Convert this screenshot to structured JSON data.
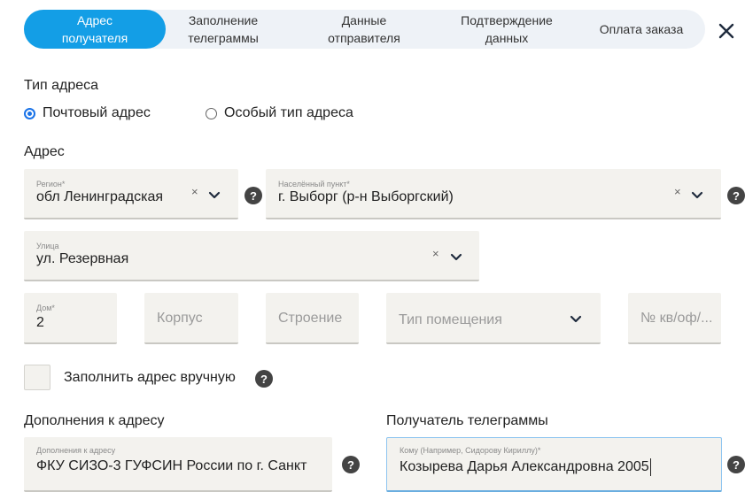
{
  "stepper": {
    "steps": [
      {
        "line1": "Адрес",
        "line2": "получателя"
      },
      {
        "line1": "Заполнение",
        "line2": "телеграммы"
      },
      {
        "line1": "Данные",
        "line2": "отправителя"
      },
      {
        "line1": "Подтверждение",
        "line2": "данных"
      },
      {
        "line1": "Оплата заказа",
        "line2": ""
      }
    ],
    "active_index": 0,
    "active_color": "#139ee6"
  },
  "address_type": {
    "label": "Тип адреса",
    "options": [
      "Почтовый адрес",
      "Особый тип адреса"
    ],
    "selected": "Почтовый адрес"
  },
  "address": {
    "label": "Адрес",
    "region": {
      "label": "Регион*",
      "value": "обл Ленинградская"
    },
    "locality": {
      "label": "Населённый пункт*",
      "value": "г. Выборг (р-н Выборгский)"
    },
    "street": {
      "label": "Улица",
      "value": "ул. Резервная"
    },
    "house": {
      "label": "Дом*",
      "value": "2"
    },
    "corpus": {
      "placeholder": "Корпус"
    },
    "building": {
      "placeholder": "Строение"
    },
    "room_type": {
      "placeholder": "Тип помещения"
    },
    "apartment": {
      "placeholder": "№ кв/оф/..."
    },
    "manual_fill": {
      "label": "Заполнить адрес вручную",
      "checked": false
    }
  },
  "additions": {
    "label": "Дополнения к адресу",
    "field_label": "Дополнения к адресу",
    "value": "ФКУ СИЗО-3 ГУФСИН России по г. Санкт"
  },
  "recipient": {
    "label": "Получатель телеграммы",
    "field_label": "Кому (Например, Сидорову Кириллу)*",
    "value": "Козырева Дарья Александровна 2005"
  },
  "help_symbol": "?",
  "clear_symbol": "×"
}
